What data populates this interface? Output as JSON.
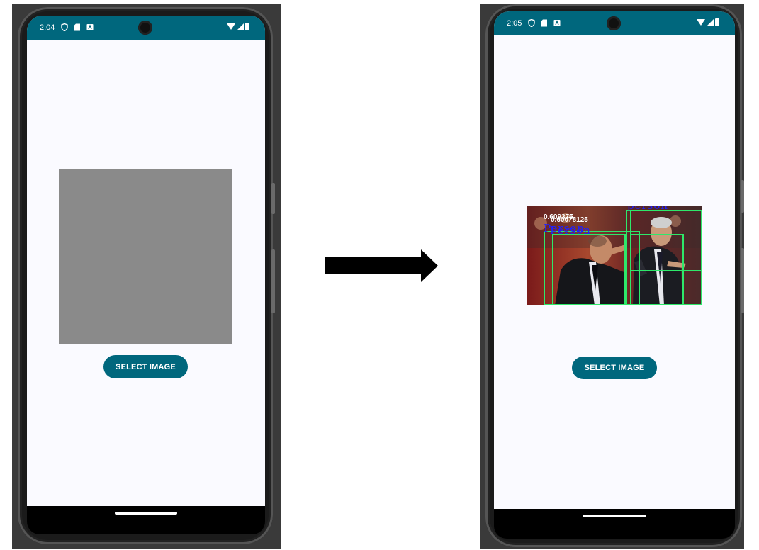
{
  "before": {
    "status": {
      "time": "2:04",
      "icons": [
        "shield-icon",
        "sd-card-icon",
        "a-badge-icon"
      ]
    },
    "button_label": "SELECT IMAGE"
  },
  "after": {
    "status": {
      "time": "2:05",
      "icons": [
        "shield-icon",
        "sd-card-icon",
        "a-badge-icon"
      ]
    },
    "button_label": "SELECT IMAGE",
    "detections": [
      {
        "score": "0.609375",
        "label": "Person"
      },
      {
        "score": "0.60078125",
        "label": "Person"
      },
      {
        "score": "",
        "label": "person"
      }
    ]
  },
  "colors": {
    "accent": "#00677d",
    "bbox": "#2ee86a",
    "label": "#2020ff",
    "screen_bg": "#fafaff",
    "placeholder": "#8a8a8a"
  }
}
